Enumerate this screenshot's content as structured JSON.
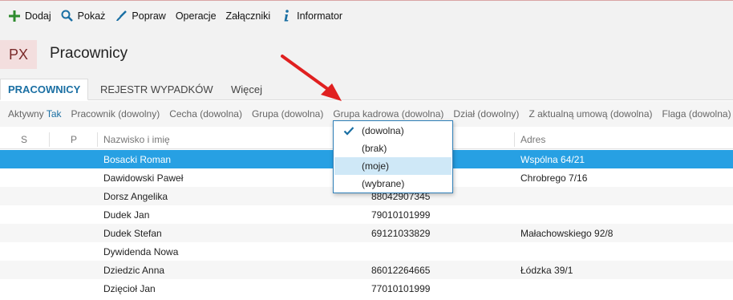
{
  "toolbar": {
    "buttons": [
      {
        "label": "Dodaj",
        "icon": "plus-icon",
        "color": "#2e8b2e"
      },
      {
        "label": "Pokaż",
        "icon": "search-icon",
        "color": "#1a6fa3"
      },
      {
        "label": "Popraw",
        "icon": "brush-icon",
        "color": "#1a6fa3"
      },
      {
        "label": "Operacje",
        "icon": ""
      },
      {
        "label": "Załączniki",
        "icon": ""
      },
      {
        "label": "Informator",
        "icon": "info-icon",
        "color": "#1a6fa3"
      }
    ]
  },
  "header": {
    "badge": "PX",
    "title": "Pracownicy"
  },
  "tabs": [
    {
      "label": "PRACOWNICY",
      "active": true
    },
    {
      "label": "REJESTR WYPADKÓW",
      "active": false
    },
    {
      "label": "Więcej",
      "active": false
    }
  ],
  "filters": [
    {
      "label": "Aktywny",
      "value": "Tak"
    },
    {
      "label": "Pracownik (dowolny)",
      "value": ""
    },
    {
      "label": "Cecha (dowolna)",
      "value": ""
    },
    {
      "label": "Grupa (dowolna)",
      "value": ""
    },
    {
      "label": "Grupa kadrowa (dowolna)",
      "value": ""
    },
    {
      "label": "Dział (dowolny)",
      "value": ""
    },
    {
      "label": "Z aktualną umową (dowolna)",
      "value": ""
    },
    {
      "label": "Flaga (dowolna)",
      "value": ""
    }
  ],
  "grid": {
    "columns": {
      "s": "S",
      "p": "P",
      "name": "Nazwisko i imię",
      "address": "Adres"
    },
    "rows": [
      {
        "name": "Bosacki Roman",
        "pesel": "",
        "address": "Wspólna 64/21",
        "selected": true
      },
      {
        "name": "Dawidowski Paweł",
        "pesel": "",
        "address": "Chrobrego 7/16"
      },
      {
        "name": "Dorsz Angelika",
        "pesel": "88042907345",
        "address": ""
      },
      {
        "name": "Dudek Jan",
        "pesel": "79010101999",
        "address": ""
      },
      {
        "name": "Dudek Stefan",
        "pesel": "69121033829",
        "address": "Małachowskiego 92/8"
      },
      {
        "name": "Dywidenda Nowa",
        "pesel": "",
        "address": ""
      },
      {
        "name": "Dziedzic Anna",
        "pesel": "86012264665",
        "address": "Łódzka 39/1"
      },
      {
        "name": "Dzięcioł Jan",
        "pesel": "77010101999",
        "address": ""
      }
    ]
  },
  "dropdown": {
    "options": [
      {
        "label": "(dowolna)",
        "checked": true
      },
      {
        "label": "(brak)"
      },
      {
        "label": "(moje)",
        "hover": true
      },
      {
        "label": "(wybrane)"
      }
    ]
  },
  "colors": {
    "accent": "#1a6fa3",
    "selection": "#27a0e3",
    "arrow": "#e02020"
  }
}
